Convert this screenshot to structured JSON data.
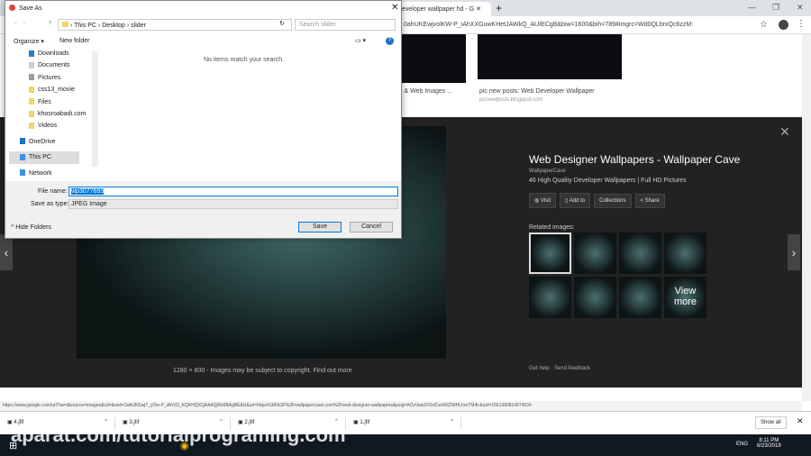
{
  "browser": {
    "tab_title": "eveloper wallpaper hd - G",
    "url": "0ahUKEwjvolKW-P_iAhXXGuwKHetJAWkQ_AUIECgB&biw=1600&bih=789#imgrc=Wd0QLbrxQc6zzM:"
  },
  "results": [
    {
      "caption": "i & Web Images ..."
    },
    {
      "caption": "pic new posts: Web Developer Wallpaper",
      "source": "picnewposts.blogspot.com"
    }
  ],
  "viewer": {
    "image_caption": "1280 × 800 - Images may be subject to copyright.",
    "find_out_more": "Find out more",
    "title": "Web Designer Wallpapers - Wallpaper Cave",
    "site": "WallpaperCave",
    "description": "46 High Quality Developer Wallpapers | Full HD Pictures",
    "buttons": [
      "Visit",
      "Add to",
      "Collections",
      "Share"
    ],
    "related_label": "Related images:",
    "view_more": "View more",
    "get_help": "Get help",
    "send_feedback": "Send feedback"
  },
  "status_url": "https://www.google.com/url?sa=i&source=images&cd=&ved=2ahUKEwj7_yOw-P_iAhVD_KQKHQXQAA4QjRx6BAgBEAU&url=https%3A%2F%2Fwallpapercave.com%2Fweb-designer-wallpapers&psig=AOvVaw1F0sICwXRZIMHLhreTM4t-&ust=1561390814974534",
  "downloads": {
    "items": [
      "4.jfif",
      "3.jfif",
      "2.jfif",
      "1.jfif"
    ],
    "show_all": "Show all"
  },
  "watermark": "aparat.com/tutorialprograming.com",
  "clock": {
    "time": "8:11 PM",
    "date": "6/23/2019",
    "lang": "ENG"
  },
  "dialog": {
    "title": "Save As",
    "breadcrumb": [
      "This PC",
      "Desktop",
      "slider"
    ],
    "search_placeholder": "Search slider",
    "organize": "Organize ▾",
    "new_folder": "New folder",
    "nav": [
      "Downloads",
      "Documents",
      "Pictures",
      "css13_movie",
      "Files",
      "khosroabadi.com",
      "Videos",
      "OneDrive",
      "This PC",
      "Network"
    ],
    "empty": "No items match your search.",
    "file_name_label": "File name:",
    "file_name": "wp3077693",
    "save_type_label": "Save as type:",
    "save_type": "JPEG Image",
    "hide_folders": "Hide Folders",
    "save": "Save",
    "cancel": "Cancel"
  }
}
